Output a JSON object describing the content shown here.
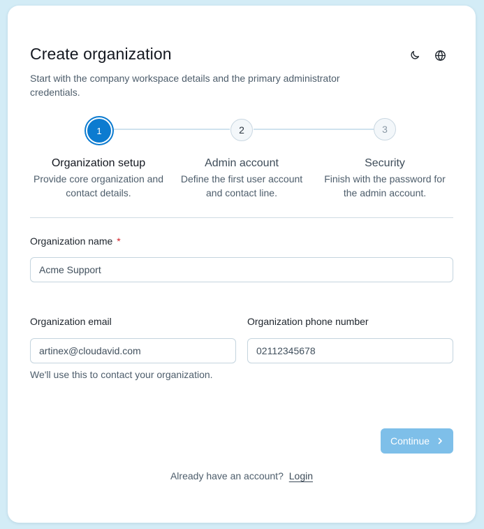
{
  "header": {
    "title": "Create organization",
    "subtitle": "Start with the company workspace details and the primary administrator credentials.",
    "icons": [
      "moon-icon",
      "globe-icon"
    ]
  },
  "stepper": {
    "current_step": 1,
    "steps": [
      {
        "number": "1",
        "title": "Organization setup",
        "desc_line1": "Provide core organization and",
        "desc_line2": "contact details."
      },
      {
        "number": "2",
        "title": "Admin account",
        "desc_line1": "Define the first user account",
        "desc_line2": "and contact line."
      },
      {
        "number": "3",
        "title": "Security",
        "desc_line1": "Finish with the password for",
        "desc_line2": "the admin account."
      }
    ]
  },
  "form": {
    "org_name_label": "Organization name",
    "required_mark": "*",
    "org_name_value": "Acme Support",
    "org_email_label": "Organization email",
    "org_email_value": "artinex@cloudavid.com",
    "org_phone_label": "Organization phone number",
    "org_phone_value": "02112345678",
    "email_helper": "We'll use this to contact your organization."
  },
  "actions": {
    "continue_label": "Continue",
    "login_prompt": "Already have an account?",
    "login_label": "Login"
  },
  "colors": {
    "accent": "#0c7bd0",
    "continue_disabled": "#7ebfe9",
    "background": "#d3ecf6",
    "required": "#d3222a"
  }
}
